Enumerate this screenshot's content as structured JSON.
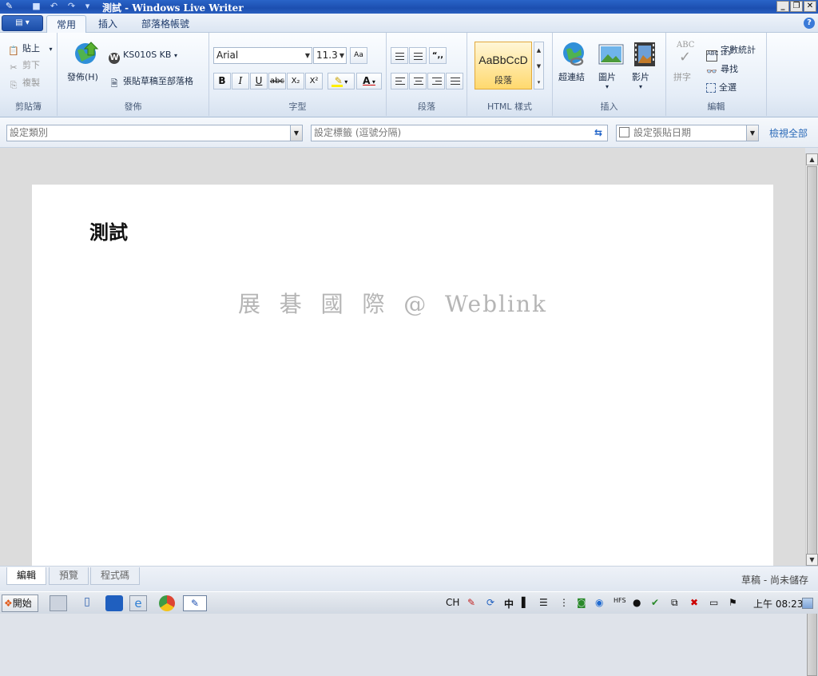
{
  "window": {
    "title": "測試 - Windows Live Writer"
  },
  "ribbon_tabs": [
    "常用",
    "插入",
    "部落格帳號"
  ],
  "clipboard": {
    "paste": "貼上",
    "cut": "剪下",
    "copy": "複製",
    "group": "剪貼簿"
  },
  "publish": {
    "publish": "發佈(H)",
    "account": "KS010S KB",
    "post_draft": "張貼草稿至部落格",
    "group": "發佈"
  },
  "font": {
    "family": "Arial",
    "size": "11.3",
    "group": "字型",
    "buttons": {
      "bold": "B",
      "italic": "I",
      "underline": "U",
      "strike": "abc",
      "sub": "X₂",
      "sup": "X²",
      "color": "A"
    }
  },
  "paragraph": {
    "group": "段落",
    "quote": "“,,"
  },
  "styles": {
    "preview": "AaBbCcD",
    "name": "段落",
    "group": "HTML 樣式"
  },
  "insert": {
    "hyperlink": "超連結",
    "picture": "圖片",
    "video": "影片",
    "group": "插入"
  },
  "editing": {
    "spell": "拼字",
    "spell_icon": "ABC",
    "wordcount": "字數統計",
    "find": "尋找",
    "selectall": "全選",
    "group": "編輯"
  },
  "meta": {
    "category_placeholder": "設定類別",
    "tags_placeholder": "設定標籤 (逗號分隔)",
    "date_placeholder": "設定張貼日期",
    "view_all": "檢視全部"
  },
  "post": {
    "title": "測試",
    "watermark": "展  碁  國  際  @  Weblink"
  },
  "views": [
    "編輯",
    "預覽",
    "程式碼"
  ],
  "status": {
    "save_state": "草稿 - 尚未儲存"
  },
  "taskbar": {
    "start": "開始",
    "lang": "CH",
    "ime": "中",
    "clock": "上午 08:23"
  },
  "colors": {
    "title_bar": "#1c4fb0",
    "style_highlight": "#ffd96e",
    "link": "#2a6ab8"
  }
}
